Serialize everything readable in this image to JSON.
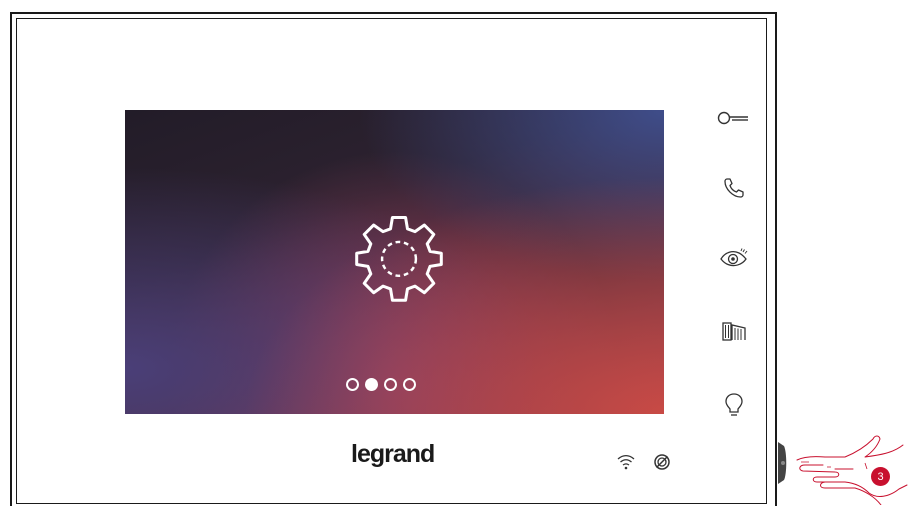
{
  "brand": {
    "logo_text": "legrand"
  },
  "screen": {
    "center_icon": "gear-icon",
    "pagination": {
      "total": 4,
      "active_index": 1
    }
  },
  "side_buttons": [
    {
      "icon": "key-icon"
    },
    {
      "icon": "phone-icon"
    },
    {
      "icon": "eye-icon"
    },
    {
      "icon": "gate-icon"
    },
    {
      "icon": "light-bulb-icon"
    }
  ],
  "status_icons": [
    "wifi-icon",
    "do-not-disturb-icon"
  ],
  "callout": {
    "step_number": "3"
  },
  "colors": {
    "accent_red": "#c8102e",
    "frame": "#1a1a1a"
  }
}
